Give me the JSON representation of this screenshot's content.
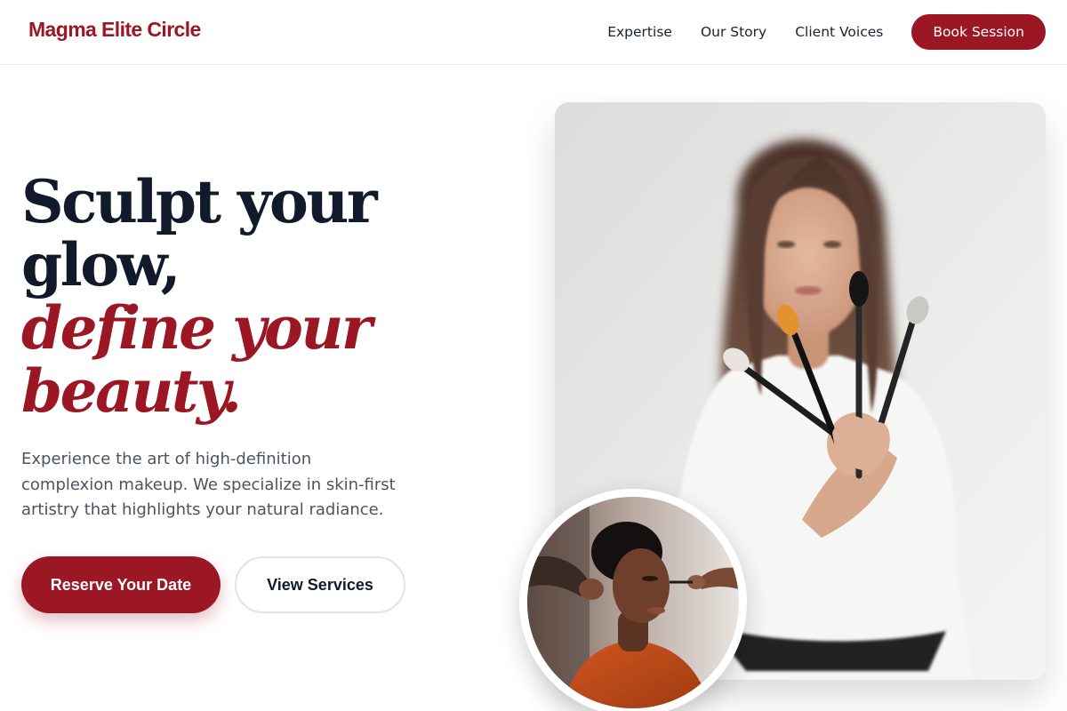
{
  "brand": {
    "name": "Magma Elite Circle"
  },
  "nav": {
    "links": [
      "Expertise",
      "Our Story",
      "Client Voices"
    ],
    "cta": "Book Session"
  },
  "hero": {
    "title_lines": [
      "Sculpt your",
      "glow,"
    ],
    "accent_lines": [
      "define your",
      "beauty."
    ],
    "description_lines": [
      "Experience the art of high-definition",
      "complexion makeup. We specialize in skin-first",
      "artistry that highlights your natural radiance."
    ],
    "primary_cta": "Reserve Your Date",
    "secondary_cta": "View Services"
  },
  "images": {
    "main_photo": "makeup-artist-holding-brushes-photo",
    "circle_photo": "client-receiving-makeup-photo"
  }
}
